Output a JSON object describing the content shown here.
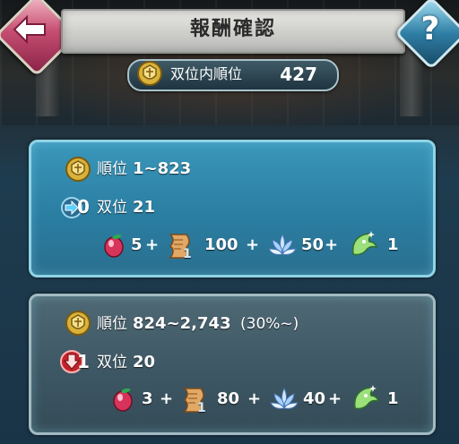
{
  "header": {
    "title": "報酬確認",
    "back_icon": "back-arrow-icon",
    "help_icon": "help-icon",
    "help_glyph": "?"
  },
  "rank_bar": {
    "label": "双位内順位",
    "value": "427"
  },
  "tiers": [
    {
      "rank_label": "順位",
      "rank_range": "1~823",
      "badge_value": "0",
      "badge_type": "up",
      "tier_label": "双位",
      "tier_value": "21",
      "rewards": [
        {
          "icon": "orb-icon",
          "qty": "5"
        },
        {
          "plus": "+",
          "icon": "scroll-icon",
          "qty": "100",
          "sub": "1"
        },
        {
          "plus": "+",
          "icon": "lotus-icon",
          "qty": "50"
        },
        {
          "plus": "+",
          "icon": "dragon-flag-icon",
          "qty": "1"
        }
      ]
    },
    {
      "rank_label": "順位",
      "rank_range": "824~2,743",
      "rank_pct": "(30%~)",
      "badge_value": "1",
      "badge_type": "down",
      "tier_label": "双位",
      "tier_value": "20",
      "rewards": [
        {
          "icon": "orb-icon",
          "qty": "3"
        },
        {
          "plus": "+",
          "icon": "scroll-icon",
          "qty": "80",
          "sub": "1"
        },
        {
          "plus": "+",
          "icon": "lotus-icon",
          "qty": "40"
        },
        {
          "plus": "+",
          "icon": "dragon-flag-icon",
          "qty": "1"
        }
      ]
    }
  ],
  "colors": {
    "panel_current": "#2a7ea2",
    "panel_next": "#3d5764",
    "back_button": "#c64e72",
    "help_button": "#2f7fa6",
    "crest_gold": "#d9b23a"
  }
}
